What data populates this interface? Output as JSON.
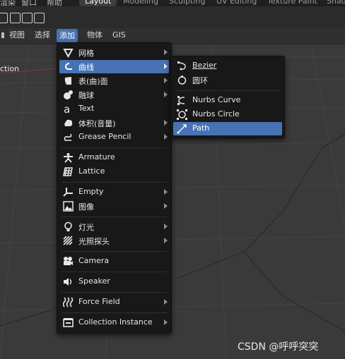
{
  "topbar": {
    "menus": [
      "渲染",
      "窗口",
      "帮助"
    ],
    "workspaces": [
      {
        "label": "Layout",
        "active": true
      },
      {
        "label": "Modeling",
        "active": false
      },
      {
        "label": "Sculpting",
        "active": false
      },
      {
        "label": "UV Editing",
        "active": false
      },
      {
        "label": "Texture Paint",
        "active": false
      },
      {
        "label": "Shadi",
        "active": false
      }
    ]
  },
  "header": {
    "menus": [
      {
        "label": "视图",
        "active": false
      },
      {
        "label": "选择",
        "active": false
      },
      {
        "label": "添加",
        "active": true
      },
      {
        "label": "物体",
        "active": false
      },
      {
        "label": "GIS",
        "active": false
      }
    ]
  },
  "viewport": {
    "left_label": "ction"
  },
  "add_menu": {
    "items": [
      {
        "label": "网格",
        "icon": "mesh-icon",
        "submenu": true
      },
      {
        "label": "曲线",
        "icon": "curve-icon",
        "submenu": true,
        "highlighted": true
      },
      {
        "label": "表(曲)面",
        "icon": "surface-icon",
        "submenu": true
      },
      {
        "label": "融球",
        "icon": "metaball-icon",
        "submenu": true
      },
      {
        "label": "Text",
        "icon": "text-icon",
        "submenu": false
      },
      {
        "label": "体积(音量)",
        "icon": "volume-icon",
        "submenu": true
      },
      {
        "label": "Grease Pencil",
        "icon": "grease-pencil-icon",
        "submenu": true
      },
      {
        "label": "Armature",
        "icon": "armature-icon",
        "submenu": false
      },
      {
        "label": "Lattice",
        "icon": "lattice-icon",
        "submenu": false
      },
      {
        "label": "Empty",
        "icon": "empty-icon",
        "submenu": true
      },
      {
        "label": "图像",
        "icon": "image-icon",
        "submenu": true
      },
      {
        "label": "灯光",
        "icon": "light-icon",
        "submenu": true
      },
      {
        "label": "光照探头",
        "icon": "light-probe-icon",
        "submenu": true
      },
      {
        "label": "Camera",
        "icon": "camera-icon",
        "submenu": false
      },
      {
        "label": "Speaker",
        "icon": "speaker-icon",
        "submenu": false
      },
      {
        "label": "Force Field",
        "icon": "force-field-icon",
        "submenu": true
      },
      {
        "label": "Collection Instance",
        "icon": "collection-instance-icon",
        "submenu": true
      }
    ]
  },
  "curve_submenu": {
    "items": [
      {
        "label": "Bezier",
        "icon": "bezier-icon"
      },
      {
        "label": "圆环",
        "icon": "circle-curve-icon"
      },
      {
        "label": "Nurbs Curve",
        "icon": "nurbs-curve-icon"
      },
      {
        "label": "Nurbs Circle",
        "icon": "nurbs-circle-icon"
      },
      {
        "label": "Path",
        "icon": "path-icon",
        "highlighted": true
      }
    ]
  },
  "watermark": "CSDN @呼呼突突",
  "colors": {
    "accent": "#4772b3",
    "menu_bg": "#181818",
    "viewport_bg": "#3a3a3a"
  }
}
